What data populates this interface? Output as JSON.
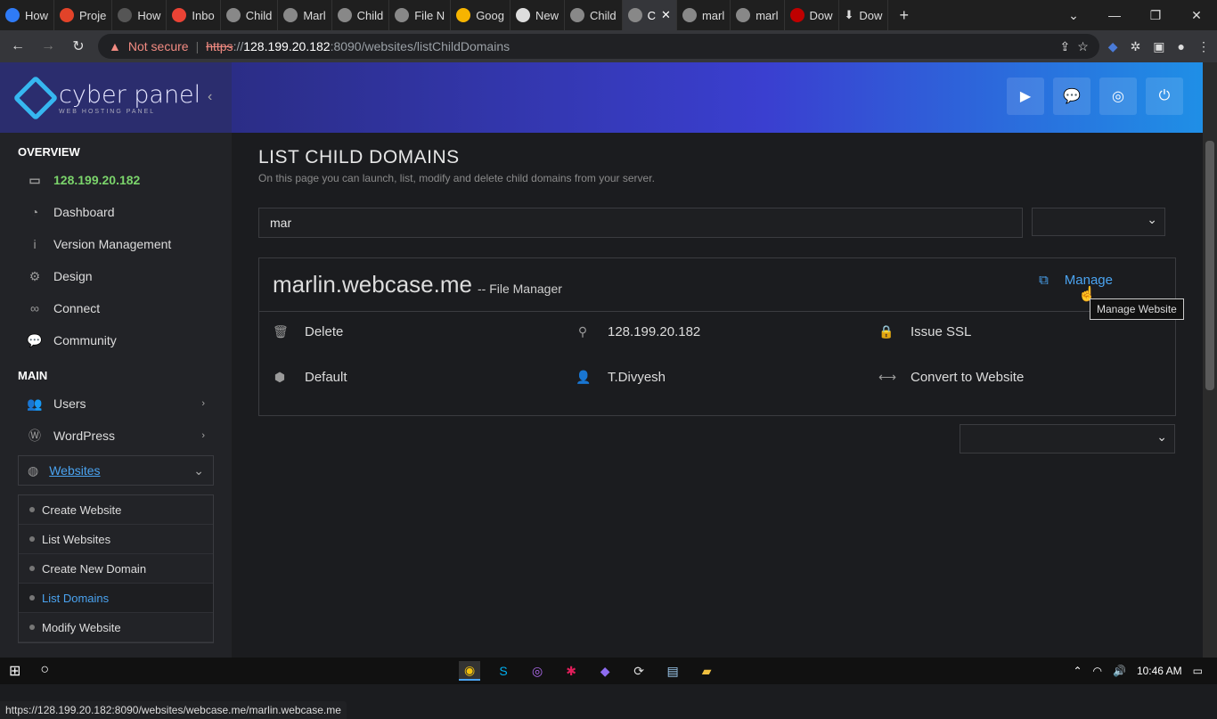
{
  "browser": {
    "tabs": [
      {
        "label": "How",
        "icon": "k-app-icon"
      },
      {
        "label": "Proje",
        "icon": "gitlab-icon"
      },
      {
        "label": "How",
        "icon": "htg-icon"
      },
      {
        "label": "Inbo",
        "icon": "gmail-icon"
      },
      {
        "label": "Child",
        "icon": "globe-icon"
      },
      {
        "label": "Marl",
        "icon": "globe-icon"
      },
      {
        "label": "Child",
        "icon": "globe-icon"
      },
      {
        "label": "File N",
        "icon": "globe-icon"
      },
      {
        "label": "Goog",
        "icon": "keep-icon"
      },
      {
        "label": "New",
        "icon": "chrome-icon"
      },
      {
        "label": "Child",
        "icon": "globe-icon"
      },
      {
        "label": "C",
        "icon": "globe-icon",
        "active": true
      },
      {
        "label": "marl",
        "icon": "globe-icon"
      },
      {
        "label": "marl",
        "icon": "globe-icon"
      },
      {
        "label": "Dow",
        "icon": "filezilla-icon"
      },
      {
        "label": "Dow",
        "icon": "download-icon"
      }
    ],
    "new_tab": "+",
    "not_secure": "Not secure",
    "url_proto": "https",
    "url_sep": "://",
    "url_host": "128.199.20.182",
    "url_rest": ":8090/websites/listChildDomains",
    "status_url": "https://128.199.20.182:8090/websites/webcase.me/marlin.webcase.me"
  },
  "sidebar": {
    "logo_text": "cyber panel",
    "logo_sub": "WEB HOSTING PANEL",
    "overview_title": "OVERVIEW",
    "ip": "128.199.20.182",
    "overview_items": [
      "Dashboard",
      "Version Management",
      "Design",
      "Connect",
      "Community"
    ],
    "main_title": "MAIN",
    "main_items": [
      "Users",
      "WordPress"
    ],
    "websites_label": "Websites",
    "sub_items": [
      "Create Website",
      "List Websites",
      "Create New Domain",
      "List Domains",
      "Modify Website"
    ],
    "active_sub": "List Domains"
  },
  "main": {
    "title": "LIST CHILD DOMAINS",
    "subtitle": "On this page you can launch, list, modify and delete child domains from your server.",
    "search_value": "mar",
    "domain": {
      "name": "marlin.webcase.me",
      "file_manager": "-- File Manager",
      "manage": "Manage",
      "tooltip": "Manage Website",
      "delete": "Delete",
      "ip": "128.199.20.182",
      "issue_ssl": "Issue SSL",
      "package": "Default",
      "owner": "T.Divyesh",
      "convert": "Convert to Website"
    }
  },
  "taskbar": {
    "time": "10:46 AM"
  },
  "colors": {
    "accent": "#4aa3f0",
    "ip_green": "#7bd46b",
    "header_start": "#2b2d86",
    "header_end": "#1f8fe6"
  }
}
